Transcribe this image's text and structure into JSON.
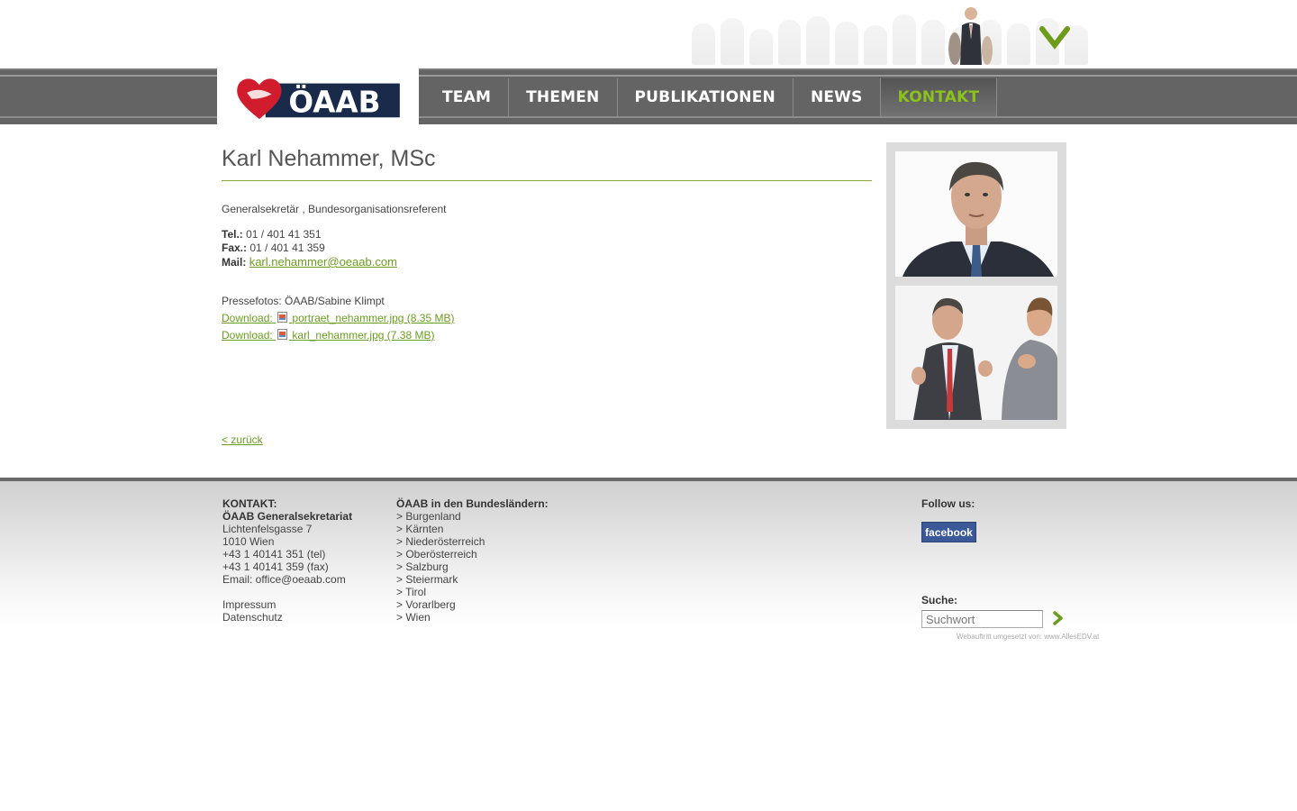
{
  "header": {
    "logo_text": "ÖAAB",
    "nav": [
      {
        "label": "TEAM"
      },
      {
        "label": "THEMEN"
      },
      {
        "label": "PUBLIKATIONEN"
      },
      {
        "label": "NEWS"
      },
      {
        "label": "KONTAKT",
        "active": true
      }
    ],
    "active_color": "#8bc21e"
  },
  "profile": {
    "name": "Karl Nehammer, MSc",
    "role": "Generalsekretär , Bundesorganisationsreferent",
    "tel_label": "Tel.:",
    "tel": "01 / 401 41 351",
    "fax_label": "Fax.:",
    "fax": "01 / 401 41 359",
    "mail_label": "Mail:",
    "mail": "karl.nehammer@oeaab.com",
    "press_credit": "Pressefotos: ÖAAB/Sabine Klimpt",
    "downloads": [
      {
        "label": "Download:",
        "file": "portraet_nehammer.jpg (8.35 MB)"
      },
      {
        "label": "Download:",
        "file": "karl_nehammer.jpg (7.38 MB)"
      }
    ],
    "back": "< zurück"
  },
  "footer": {
    "kontakt": {
      "heading": "KONTAKT:",
      "org": "ÖAAB Generalsekretariat",
      "street": "Lichtenfelsgasse 7",
      "city": "1010 Wien",
      "tel": "+43 1 40141 351 (tel)",
      "fax": "+43 1 40141 359 (fax)",
      "email": "Email: office@oeaab.com",
      "impressum": "Impressum",
      "datenschutz": "Datenschutz"
    },
    "laender": {
      "heading": "ÖAAB in den Bundesländern:",
      "items": [
        "> Burgenland",
        "> Kärnten",
        "> Niederösterreich",
        "> Oberösterreich",
        "> Salzburg",
        "> Steiermark",
        "> Tirol",
        "> Vorarlberg",
        "> Wien"
      ]
    },
    "follow": "Follow us:",
    "facebook": "facebook",
    "search_label": "Suche:",
    "search_placeholder": "Suchwort",
    "credit": "Webauftritt umgesetzt von: www.AllesEDV.at"
  },
  "colors": {
    "link_green": "#6b9d1e",
    "nav_gray": "#646464",
    "facebook_blue": "#3b5998"
  }
}
